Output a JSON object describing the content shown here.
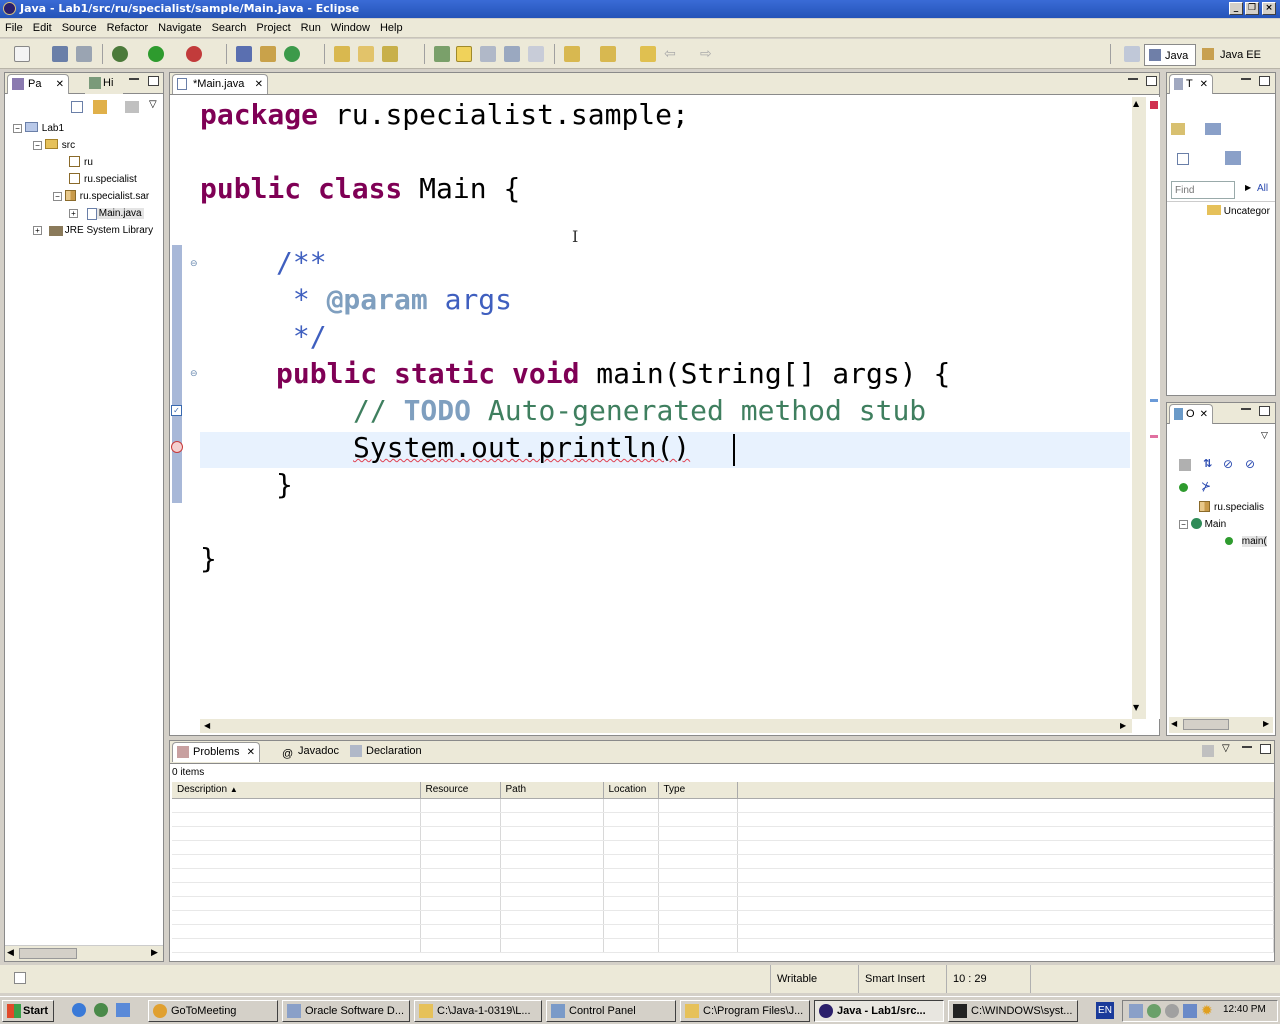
{
  "window": {
    "title": "Java - Lab1/src/ru/specialist/sample/Main.java - Eclipse"
  },
  "menu": [
    "File",
    "Edit",
    "Source",
    "Refactor",
    "Navigate",
    "Search",
    "Project",
    "Run",
    "Window",
    "Help"
  ],
  "perspectives": {
    "java": "Java",
    "javaee": "Java EE"
  },
  "package_explorer": {
    "tab1": "Pa",
    "tab2": "Hi",
    "tree": {
      "project": "Lab1",
      "src": "src",
      "pkg1": "ru",
      "pkg2": "ru.specialist",
      "pkg3": "ru.specialist.sar",
      "file": "Main.java",
      "jre": "JRE System Library"
    }
  },
  "editor": {
    "tab": "*Main.java",
    "lines": {
      "l1_kw": "package",
      "l1_rest": " ru.specialist.sample;",
      "l2_kw": "public class",
      "l2_rest": " Main {",
      "l3": "/**",
      "l4_star": " * ",
      "l4_tag": "@param",
      "l4_rest": " args",
      "l5": " */",
      "l6_kw": "public static void",
      "l6_rest": " main(String[] args) {",
      "l7_slashes": "// ",
      "l7_todo": "TODO",
      "l7_rest": " Auto-generated method stub",
      "l8": "System.out.println()",
      "l9": "}",
      "l10": "}"
    }
  },
  "task_list": {
    "tab": "T",
    "find_placeholder": "Find",
    "all": "All",
    "uncategorized": "Uncategor"
  },
  "outline": {
    "tab": "O",
    "items": {
      "pkg": "ru.specialis",
      "cls": "Main",
      "method": "main("
    }
  },
  "bottom": {
    "tabs": {
      "problems": "Problems",
      "javadoc": "Javadoc",
      "declaration": "Declaration"
    },
    "count": "0 items",
    "columns": {
      "description": "Description",
      "resource": "Resource",
      "path": "Path",
      "location": "Location",
      "type": "Type"
    }
  },
  "status": {
    "writable": "Writable",
    "insert": "Smart Insert",
    "position": "10 : 29"
  },
  "taskbar": {
    "start": "Start",
    "tasks": {
      "t1": "GoToMeeting",
      "t2": "Oracle Software D...",
      "t3": "C:\\Java-1-0319\\L...",
      "t4": "Control Panel",
      "t5": "C:\\Program Files\\J...",
      "t6": "Java - Lab1/src...",
      "t7": "C:\\WINDOWS\\syst..."
    },
    "lang": "EN",
    "clock": "12:40 PM"
  }
}
